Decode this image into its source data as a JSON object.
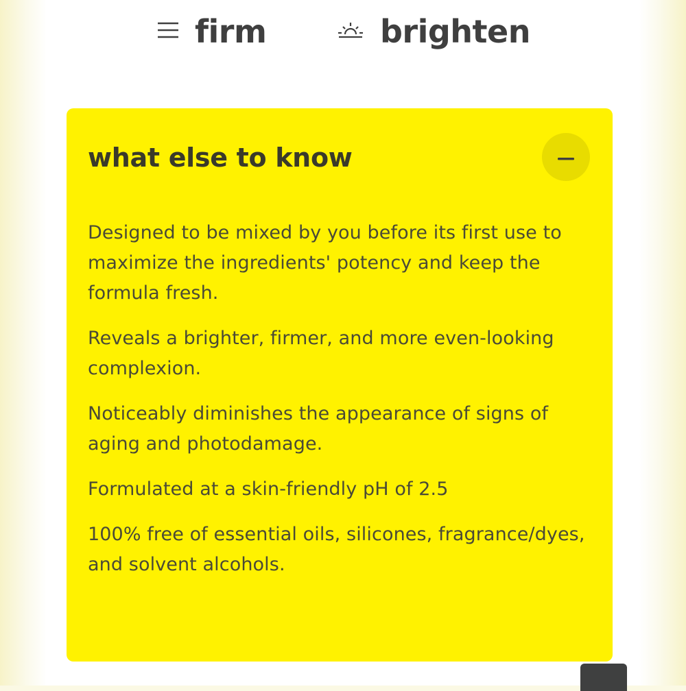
{
  "header": {
    "nav": [
      {
        "label": "firm",
        "icon": "menu-icon"
      },
      {
        "label": "brighten",
        "icon": "sun-icon"
      }
    ]
  },
  "card": {
    "title": "what else to know",
    "toggle_icon": "minus-icon",
    "paragraphs": [
      "Designed to be mixed by you before its first use to maximize the ingredients' potency and keep the formula fresh.",
      "Reveals a brighter, firmer, and more even-looking complexion.",
      "Noticeably diminishes the appearance of signs of aging and photodamage.",
      "Formulated at a skin-friendly pH of 2.5",
      "100% free of essential oils, silicones, fragrance/dyes, and solvent alcohols."
    ]
  },
  "colors": {
    "card_background": "#fff200",
    "toggle_background": "#e8dc00",
    "text": "#3f3f3f",
    "scroll_button": "#3f4040"
  }
}
